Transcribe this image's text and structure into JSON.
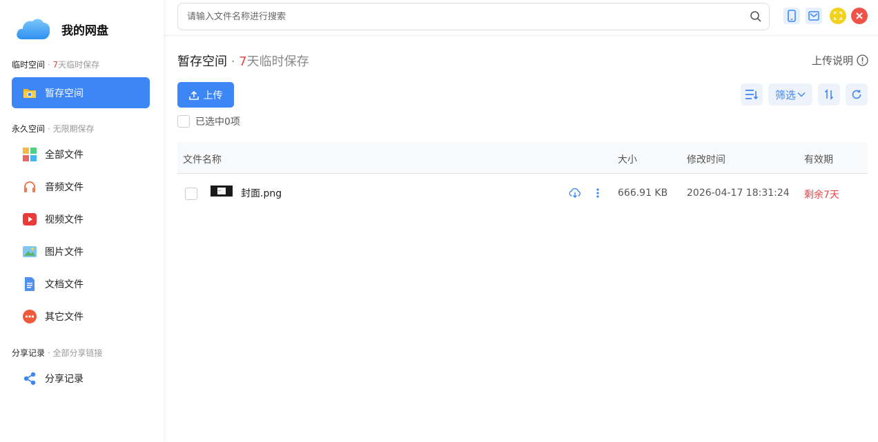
{
  "sidebar": {
    "title": "我的网盘",
    "temp_section": {
      "label": "临时空间",
      "sep": " · ",
      "highlight": "7",
      "note": "天临时保存"
    },
    "temp_items": [
      {
        "label": "暂存空间",
        "icon": "folder-icon",
        "active": true
      }
    ],
    "perm_section": {
      "label": "永久空间",
      "sep": " · ",
      "note": "无限期保存"
    },
    "perm_items": [
      {
        "label": "全部文件",
        "icon": "grid-icon"
      },
      {
        "label": "音频文件",
        "icon": "headphones-icon"
      },
      {
        "label": "视频文件",
        "icon": "play-icon"
      },
      {
        "label": "图片文件",
        "icon": "image-icon"
      },
      {
        "label": "文档文件",
        "icon": "document-icon"
      },
      {
        "label": "其它文件",
        "icon": "more-icon"
      }
    ],
    "share_section": {
      "label": "分享记录",
      "sep": " · ",
      "note": "全部分享链接"
    },
    "share_items": [
      {
        "label": "分享记录",
        "icon": "share-icon"
      }
    ]
  },
  "search": {
    "placeholder": "请输入文件名称进行搜索"
  },
  "header": {
    "title": "暂存空间",
    "sep": " · ",
    "highlight": "7",
    "note": "天临时保存",
    "help_label": "上传说明"
  },
  "toolbar": {
    "upload_label": "上传",
    "filter_label": "筛选",
    "selected_text": "已选中0项"
  },
  "table": {
    "columns": [
      "文件名称",
      "大小",
      "修改时间",
      "有效期"
    ],
    "rows": [
      {
        "name": "封面.png",
        "size": "666.91 KB",
        "modified": "2026-04-17 18:31:24",
        "expiry": "剩余7天"
      }
    ]
  },
  "colors": {
    "accent": "#3d86f5",
    "danger": "#e54545",
    "warn": "#f2d21c",
    "close": "#f0524a"
  }
}
